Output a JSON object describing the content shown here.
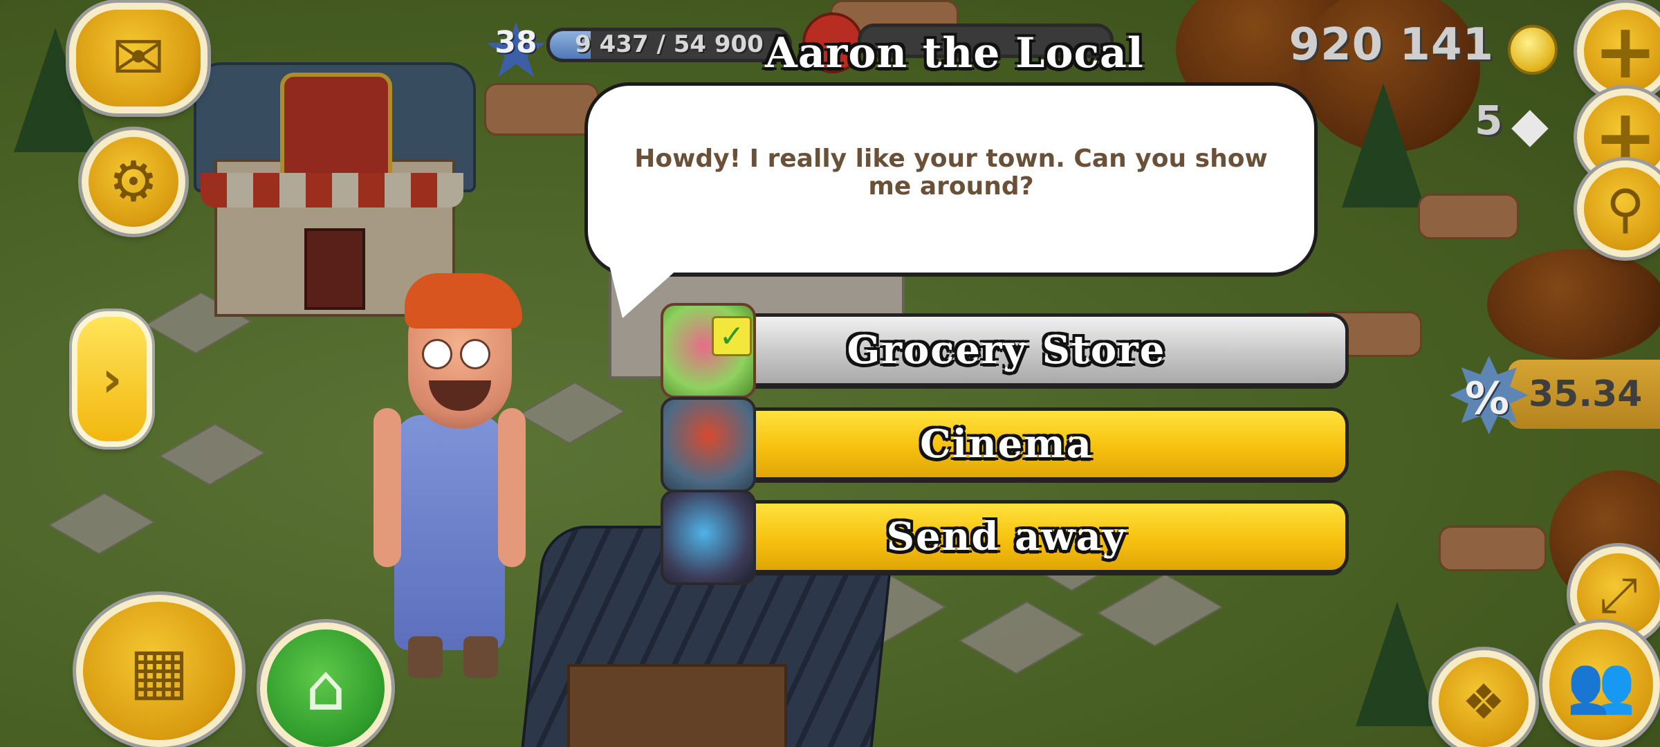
{
  "hud": {
    "level": "38",
    "xp_text": "9 437 / 54 900",
    "xp_progress": 0.17,
    "coins": "920 141",
    "diamonds": "5",
    "sale_percent": "%",
    "sale_timer": "35.34",
    "icons": {
      "mail": "envelope-icon",
      "settings": "gear-icon",
      "search": "magnifier-icon",
      "cash_register": "cash-register-icon",
      "home": "home-icon",
      "cards": "cards-icon",
      "friends": "people-icon",
      "expand": "expand-icon",
      "side_tab": "chevron-right-icon"
    }
  },
  "dialog": {
    "npc_name": "Aaron the Local",
    "message": "Howdy! I really like your town. Can you show me around?",
    "choices": [
      {
        "label": "Grocery Store",
        "icon": "grocery-store-icon",
        "style": "grey",
        "checked": true
      },
      {
        "label": "Cinema",
        "icon": "cinema-icon",
        "style": "yellow",
        "checked": false
      },
      {
        "label": "Send away",
        "icon": "train-icon",
        "style": "yellow",
        "checked": false
      }
    ]
  },
  "colors": {
    "choice_yellow": "#f7c10f",
    "choice_grey": "#c7c7c7",
    "bubble_text": "#6b5038",
    "hud_gold": "#d99a0f",
    "hud_green": "#2e9a2a"
  }
}
